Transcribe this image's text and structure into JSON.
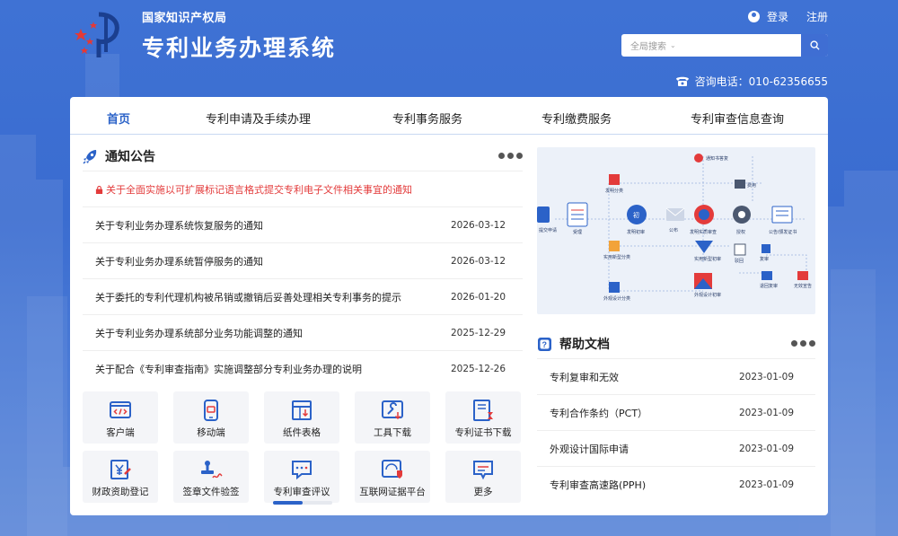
{
  "header": {
    "org_name": "国家知识产权局",
    "system_title": "专利业务办理系统",
    "login_label": "登录",
    "register_label": "注册",
    "search_scope": "全局搜索",
    "search_placeholder": "",
    "hotline_label": "咨询电话：010-62356655"
  },
  "nav": {
    "items": [
      {
        "label": "首页",
        "active": true
      },
      {
        "label": "专利申请及手续办理"
      },
      {
        "label": "专利事务服务"
      },
      {
        "label": "专利缴费服务"
      },
      {
        "label": "专利审查信息查询"
      }
    ]
  },
  "notices": {
    "title": "通知公告",
    "pinned": "关于全面实施以可扩展标记语言格式提交专利电子文件相关事宜的通知",
    "items": [
      {
        "text": "关于专利业务办理系统恢复服务的通知",
        "date": "2026-03-12"
      },
      {
        "text": "关于专利业务办理系统暂停服务的通知",
        "date": "2026-03-12"
      },
      {
        "text": "关于委托的专利代理机构被吊销或撤销后妥善处理相关专利事务的提示",
        "date": "2026-01-20"
      },
      {
        "text": "关于专利业务办理系统部分业务功能调整的通知",
        "date": "2025-12-29"
      },
      {
        "text": "关于配合《专利审查指南》实施调整部分专利业务办理的说明",
        "date": "2025-12-26"
      }
    ]
  },
  "tiles": [
    {
      "label": "客户端",
      "icon": "code-icon"
    },
    {
      "label": "移动端",
      "icon": "mobile-icon"
    },
    {
      "label": "纸件表格",
      "icon": "table-icon"
    },
    {
      "label": "工具下载",
      "icon": "tools-icon"
    },
    {
      "label": "专利证书下载",
      "icon": "certificate-icon"
    },
    {
      "label": "财政资助登记",
      "icon": "yuan-icon"
    },
    {
      "label": "签章文件验签",
      "icon": "stamp-icon"
    },
    {
      "label": "专利审查评议",
      "icon": "comment-icon"
    },
    {
      "label": "互联网证据平台",
      "icon": "web-shield-icon"
    },
    {
      "label": "更多",
      "icon": "more-chat-icon"
    }
  ],
  "tiles_scroll_fraction": 0.5,
  "flowchart": {
    "labels": [
      "提交申请",
      "受理",
      "发明初审",
      "公布",
      "发明实质审查",
      "授权",
      "公告/颁发证书",
      "发明分类",
      "实用新型分类",
      "实用新型初审",
      "外观设计分类",
      "外观设计初审",
      "驳回",
      "复审",
      "通知书答复",
      "费用",
      "退回复审",
      "无效宣告"
    ],
    "init_badge": "初"
  },
  "help": {
    "title": "帮助文档",
    "items": [
      {
        "text": "专利复审和无效",
        "date": "2023-01-09"
      },
      {
        "text": "专利合作条约（PCT）",
        "date": "2023-01-09"
      },
      {
        "text": "外观设计国际申请",
        "date": "2023-01-09"
      },
      {
        "text": "专利审查高速路(PPH)",
        "date": "2023-01-09"
      }
    ]
  },
  "colors": {
    "brand_blue": "#2b62c8",
    "header_bg": "#3f72d4",
    "alert_red": "#e33b3b"
  }
}
